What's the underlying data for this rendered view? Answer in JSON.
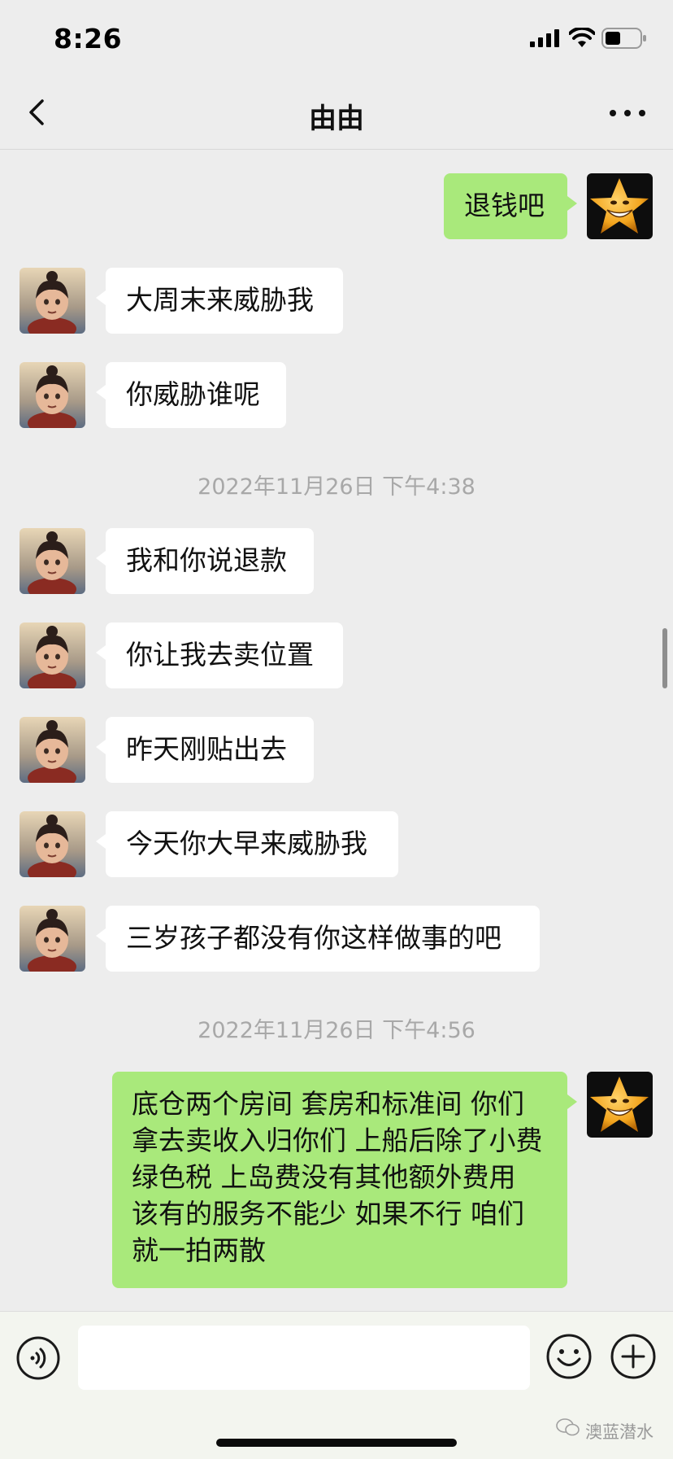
{
  "status_bar": {
    "time": "8:26"
  },
  "nav": {
    "title": "由由"
  },
  "messages": [
    {
      "side": "out",
      "text": "退钱吧"
    },
    {
      "side": "in",
      "text": "大周末来威胁我"
    },
    {
      "side": "in",
      "text": "你威胁谁呢"
    },
    {
      "type": "time",
      "text": "2022年11月26日 下午4:38"
    },
    {
      "side": "in",
      "text": "我和你说退款"
    },
    {
      "side": "in",
      "text": "你让我去卖位置"
    },
    {
      "side": "in",
      "text": "昨天刚贴出去"
    },
    {
      "side": "in",
      "text": "今天你大早来威胁我"
    },
    {
      "side": "in",
      "text": "三岁孩子都没有你这样做事的吧"
    },
    {
      "type": "time",
      "text": "2022年11月26日 下午4:56"
    },
    {
      "side": "out",
      "text": "底仓两个房间 套房和标准间 你们拿去卖收入归你们 上船后除了小费 绿色税 上岛费没有其他额外费用 该有的服务不能少 如果不行 咱们就一拍两散"
    }
  ],
  "input": {
    "placeholder": ""
  },
  "watermark": {
    "text": "澳蓝潜水"
  },
  "colors": {
    "outgoing_bubble": "#a9e97b",
    "incoming_bubble": "#ffffff",
    "background": "#ededed"
  }
}
